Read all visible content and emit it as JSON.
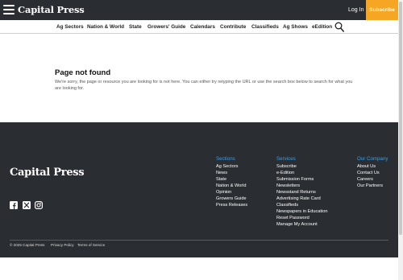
{
  "header": {
    "logo": "Capital Press",
    "login_label": "Log In",
    "subscribe_label": "Subscribe",
    "accent_color": "#f5a623"
  },
  "nav": {
    "items": [
      "Ag Sectors",
      "Nation & World",
      "State",
      "Growers' Guide",
      "Calendars",
      "Contribute",
      "Classifieds",
      "Ag Shows",
      "eEdition"
    ],
    "search_icon": "search-icon"
  },
  "main": {
    "title": "Page not found",
    "message": "We're sorry, the page or resource you are looking for is not here. You can either try retyping the URL or use the search box below to search for what you are looking for."
  },
  "footer": {
    "logo": "Capital Press",
    "social_icons": [
      "facebook-icon",
      "x-icon",
      "instagram-icon"
    ],
    "columns": [
      {
        "title": "Sections",
        "links": [
          "Ag Sectors",
          "News",
          "State",
          "Nation & World",
          "Opinion",
          "Growers Guide",
          "Press Releases"
        ]
      },
      {
        "title": "Services",
        "links": [
          "Subscribe",
          "e-Edition",
          "Submission Forms",
          "Newsletters",
          "Newsstand Returns",
          "Advertising Rate Card",
          "Classifieds",
          "Newspapers in Education",
          "Reset Password",
          "Manage My Account"
        ]
      },
      {
        "title": "Our Company",
        "links": [
          "About Us",
          "Contact Us",
          "Careers",
          "Our Partners"
        ]
      }
    ],
    "legal": {
      "copyright": "© 2025 Capital Press",
      "privacy": "Privacy Policy",
      "terms": "Terms of Service"
    }
  }
}
